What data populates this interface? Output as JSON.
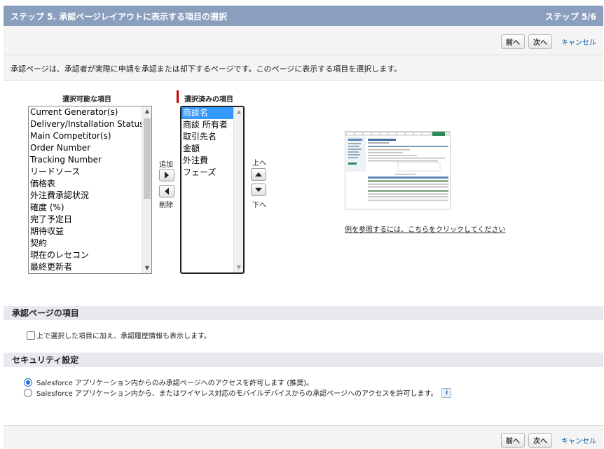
{
  "header": {
    "title": "ステップ 5. 承認ページレイアウトに表示する項目の選択",
    "step": "ステップ 5/6"
  },
  "buttons": {
    "prev": "前へ",
    "next": "次へ",
    "cancel": "キャンセル"
  },
  "description": "承認ページは、承認者が実際に申請を承認または却下するページです。このページに表示する項目を選択します。",
  "available": {
    "title": "選択可能な項目",
    "items": [
      "Current Generator(s)",
      "Delivery/Installation Status",
      "Main Competitor(s)",
      "Order Number",
      "Tracking Number",
      "リードソース",
      "価格表",
      "外注費承認状況",
      "確度 (%)",
      "完了予定日",
      "期待収益",
      "契約",
      "現在のレセコン",
      "最終更新者"
    ]
  },
  "selected": {
    "title": "選択済みの項目",
    "items": [
      "商談名",
      "商談 所有者",
      "取引先名",
      "金額",
      "外注費",
      "フェーズ"
    ],
    "selected_item": "商談名"
  },
  "move": {
    "add": "追加",
    "remove": "削除",
    "up": "上へ",
    "down": "下へ"
  },
  "preview": {
    "link": "例を参照するには、こちらをクリックしてください"
  },
  "approval_section": {
    "title": "承認ページの項目",
    "checkbox_label": "上で選択した項目に加え、承認履歴情報も表示します。",
    "checked": false
  },
  "security_section": {
    "title": "セキュリティ設定",
    "options": [
      {
        "label": "Salesforce アプリケーション内からのみ承認ページへのアクセスを許可します (推奨)。",
        "selected": true
      },
      {
        "label": "Salesforce アプリケーション内から、またはワイヤレス対応のモバイルデバイスからの承認ページへのアクセスを許可します。",
        "selected": false
      }
    ],
    "info_icon": "i"
  },
  "colors": {
    "header_bg": "#8a9ebe",
    "selection": "#3399ff",
    "link": "#015ba7",
    "required_marker": "#cc0000"
  }
}
